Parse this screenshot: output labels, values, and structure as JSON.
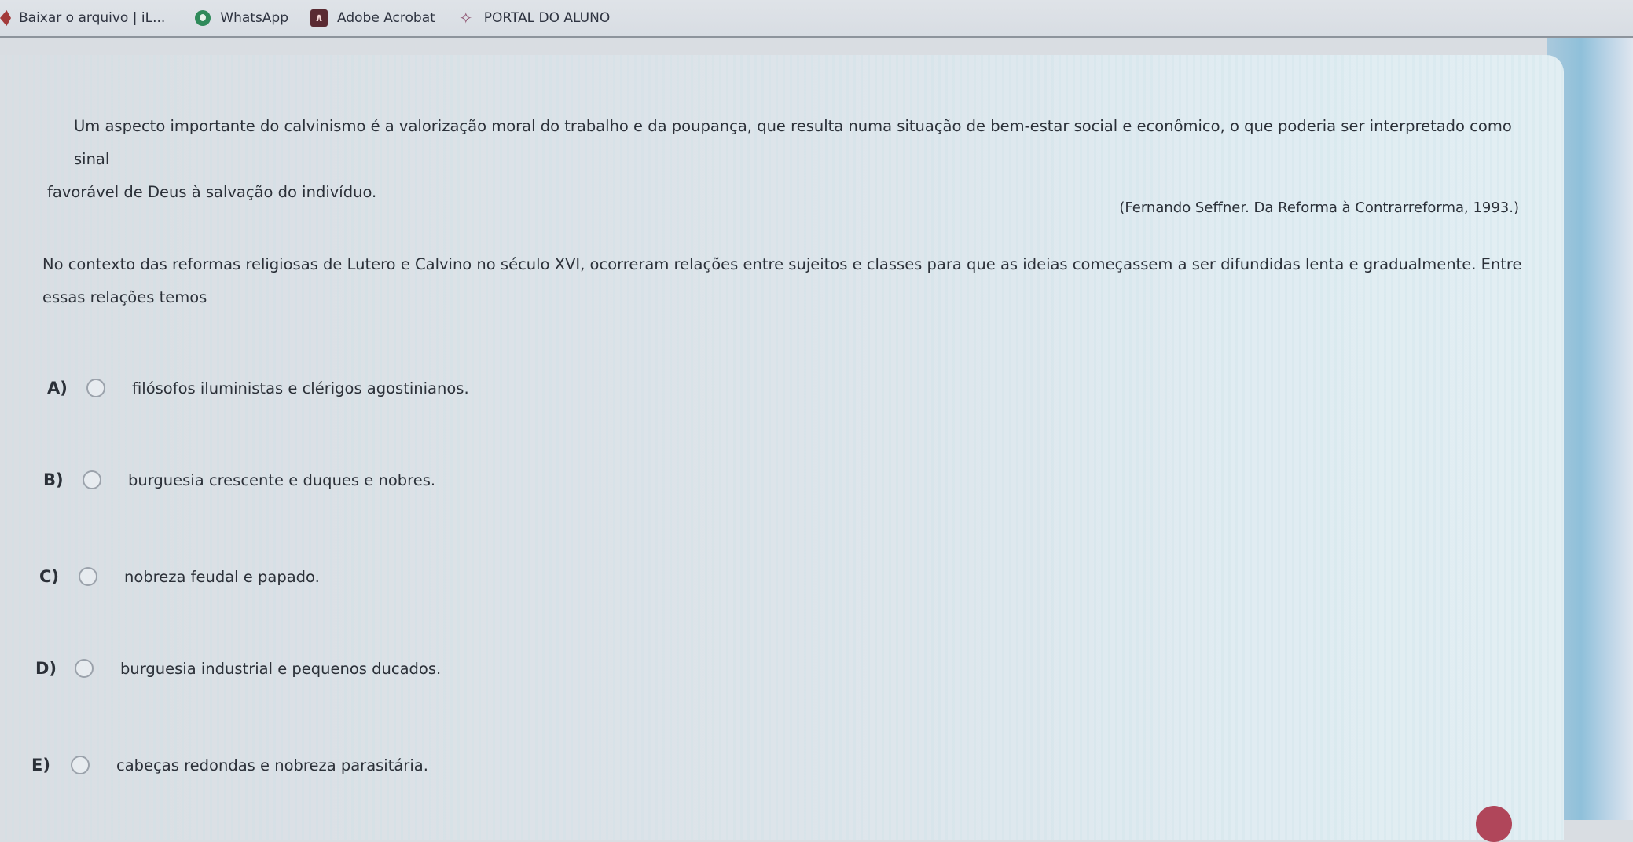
{
  "bookmarks": [
    {
      "label": "Baixar o arquivo | iL...",
      "icon": "ilovepdf-icon"
    },
    {
      "label": "WhatsApp",
      "icon": "whatsapp-icon"
    },
    {
      "label": "Adobe Acrobat",
      "icon": "acrobat-icon"
    },
    {
      "label": "PORTAL DO ALUNO",
      "icon": "portal-star-icon"
    }
  ],
  "question": {
    "quote_line1": "Um aspecto importante do calvinismo é a valorização moral do trabalho e da poupança, que resulta numa situação de bem-estar social e econômico, o que poderia ser interpretado como sinal",
    "quote_line2": "favorável de Deus à salvação do indivíduo.",
    "citation": "(Fernando Seffner. Da Reforma à Contrarreforma, 1993.)",
    "prompt": "No contexto das reformas religiosas de Lutero e Calvino no século XVI, ocorreram relações entre sujeitos e classes para que as ideias começassem a ser difundidas lenta e gradualmente. Entre essas relações temos",
    "options": [
      {
        "letter": "A)",
        "text": "filósofos iluministas e clérigos agostinianos.",
        "selected": false
      },
      {
        "letter": "B)",
        "text": "burguesia crescente e duques e nobres.",
        "selected": false
      },
      {
        "letter": "C)",
        "text": "nobreza feudal e papado.",
        "selected": false
      },
      {
        "letter": "D)",
        "text": "burguesia industrial e pequenos ducados.",
        "selected": false
      },
      {
        "letter": "E)",
        "text": "cabeças redondas e nobreza parasitária.",
        "selected": false
      }
    ]
  },
  "colors": {
    "text": "#2b3038",
    "radio_border": "#9ba2ab",
    "fab": "#b0465a"
  }
}
